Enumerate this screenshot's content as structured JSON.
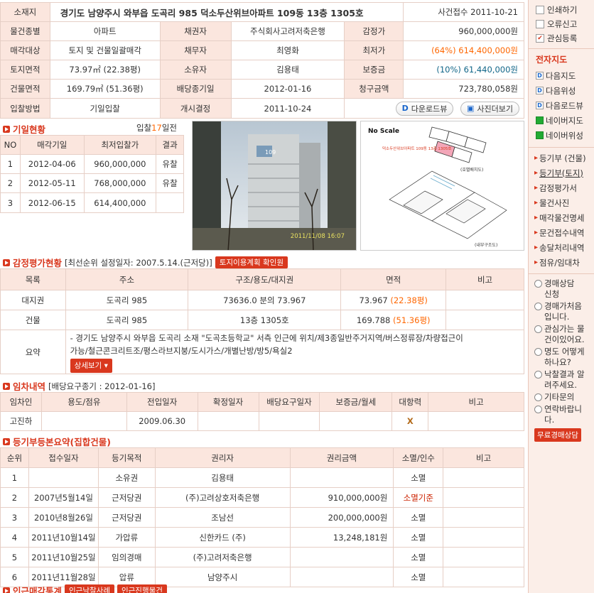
{
  "info": {
    "address_label": "소재지",
    "address": "경기도 남양주시 와부읍 도곡리 985 덕소두산위브아파트 109동 13층 1305호",
    "received": "사건접수 2011-10-21",
    "rows": [
      [
        "물건종별",
        "아파트",
        "채권자",
        "주식회사고려저축은행",
        "감정가",
        "960,000,000원"
      ],
      [
        "매각대상",
        "토지 및 건물일괄매각",
        "채무자",
        "최영화",
        "최저가",
        "(64%) 614,400,000원"
      ],
      [
        "토지면적",
        "73.97㎡ (22.38평)",
        "소유자",
        "김용태",
        "보증금",
        "(10%) 61,440,000원"
      ],
      [
        "건물면적",
        "169.79㎡ (51.36평)",
        "배당종기일",
        "2012-01-16",
        "청구금액",
        "723,780,058원"
      ],
      [
        "입찰방법",
        "기일입찰",
        "개시결정",
        "2011-10-24",
        "",
        ""
      ]
    ],
    "download_view": "다운로드뷰",
    "photo_view": "사진더보기"
  },
  "schedule": {
    "title": "기일현황",
    "dday_prefix": "입찰",
    "dday_num": "17",
    "dday_suffix": "일전",
    "headers": [
      "NO",
      "매각기일",
      "최저입찰가",
      "결과"
    ],
    "rows": [
      [
        "1",
        "2012-04-06",
        "960,000,000",
        "유찰"
      ],
      [
        "2",
        "2012-05-11",
        "768,000,000",
        "유찰"
      ],
      [
        "3",
        "2012-06-15",
        "614,400,000",
        ""
      ]
    ]
  },
  "photo": {
    "timestamp": "2011/11/08 16:07",
    "building_no": "109"
  },
  "floorplan": {
    "scale": "No   Scale",
    "caption_top": "(호별배치도)",
    "caption_bottom": "(내부구조도)",
    "building_label": "덕소두산위브아파트 109동 13층 1305호"
  },
  "appraisal": {
    "title": "감정평가현황",
    "sub": "[최선순위 설정일자: 2007.5.14.(근저당)]",
    "button": "토지이용계획 확인원",
    "headers": [
      "목록",
      "주소",
      "구조/용도/대지권",
      "면적",
      "비고"
    ],
    "rows": [
      [
        "대지권",
        "도곡리 985",
        "73636.0 분의 73.967",
        "73.967",
        "(22.38평)"
      ],
      [
        "건물",
        "도곡리 985",
        "13층 1305호",
        "169.788",
        "(51.36평)"
      ]
    ],
    "summary_label": "요약",
    "summary_line1": "- 경기도 남양주시 와부읍 도곡리 소재 \"도곡초등학교\" 서측 인근에 위치/제3종일반주거지역/버스정류장/차량접근이",
    "summary_line2": "가능/철근콘크리트조/평스라브지붕/도시가스/개별난방/방5/욕실2",
    "detail_button": "상세보기"
  },
  "lease": {
    "title": "임차내역",
    "sub": "[배당요구종기 : 2012-01-16]",
    "headers": [
      "임차인",
      "용도/점유",
      "전입일자",
      "확정일자",
      "배당요구일자",
      "보증금/월세",
      "대항력",
      "비고"
    ],
    "row": [
      "고진하",
      "",
      "2009.06.30",
      "",
      "",
      "",
      "X",
      ""
    ]
  },
  "registry": {
    "title": "등기부등본요약(집합건물)",
    "headers": [
      "순위",
      "접수일자",
      "등기목적",
      "권리자",
      "권리금액",
      "소멸/인수",
      "비고"
    ],
    "rows": [
      [
        "1",
        "",
        "소유권",
        "김용태",
        "",
        "소멸",
        ""
      ],
      [
        "2",
        "2007년5월14일",
        "근저당권",
        "(주)고려상호저축은행",
        "910,000,000원",
        "소멸기준",
        ""
      ],
      [
        "3",
        "2010년8월26일",
        "근저당권",
        "조남선",
        "200,000,000원",
        "소멸",
        ""
      ],
      [
        "4",
        "2011년10월14일",
        "가압류",
        "신한카드 (주)",
        "13,248,181원",
        "소멸",
        ""
      ],
      [
        "5",
        "2011년10월25일",
        "임의경매",
        "(주)고려저축은행",
        "",
        "소멸",
        ""
      ],
      [
        "6",
        "2011년11월28일",
        "압류",
        "남양주시",
        "",
        "소멸",
        ""
      ]
    ]
  },
  "footer": {
    "title": "인근매각통계",
    "btn1": "인근낙찰사례",
    "btn2": "인근진행물건"
  },
  "sidebar": {
    "top": [
      "인쇄하기",
      "오류신고",
      "관심등록"
    ],
    "map_title": "전자지도",
    "maps": [
      "다음지도",
      "다음위성",
      "다음로드뷰",
      "네이버지도",
      "네이버위성"
    ],
    "links": [
      "등기부 (건물)",
      "등기부(토지)",
      "감정평가서",
      "물건사진",
      "매각물건명세",
      "문건접수내역",
      "송달처리내역",
      "점유/임대차"
    ],
    "radios": [
      [
        "경매상담",
        "신청"
      ],
      [
        "경매가처음",
        "입니다."
      ],
      [
        "관심가는 물",
        "건이있어요."
      ],
      [
        "명도 어떻게",
        "하나요?"
      ],
      [
        "낙찰결과 알",
        "려주세요."
      ],
      [
        "기타문의"
      ],
      [
        "연락바랍니",
        "다."
      ]
    ],
    "consult_button": "무료경매상담"
  }
}
